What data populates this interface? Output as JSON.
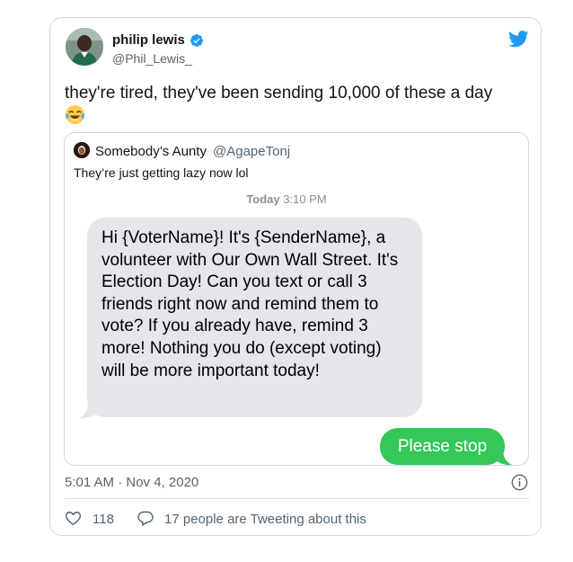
{
  "tweet": {
    "author_name": "philip lewis",
    "author_handle": "@Phil_Lewis_",
    "text": "they're tired, they've been sending 10,000 of these a day",
    "emoji_icon": "face-with-tears-of-joy-icon",
    "timestamp": "5:01 AM · Nov 4, 2020",
    "like_count": "118",
    "quote_tweets_text": "17 people are Tweeting about this"
  },
  "quote": {
    "author_name": "Somebody’s Aunty",
    "author_handle": "@AgapeTonj",
    "text": "They’re just getting lazy now lol",
    "message_time_day": "Today",
    "message_time": "3:10 PM",
    "incoming_message": "Hi {VoterName}! It's {SenderName}, a volunteer with Our Own Wall Street. It's Election Day! Can you text or call 3 friends right now and remind them to vote? If you already have, remind 3 more! Nothing you do (except voting) will be more important today!",
    "outgoing_message": "Please stop"
  },
  "colors": {
    "twitter_blue": "#1d9bf0",
    "incoming_bubble": "#e5e5ea",
    "outgoing_bubble": "#34c759",
    "secondary_text": "#536471"
  }
}
